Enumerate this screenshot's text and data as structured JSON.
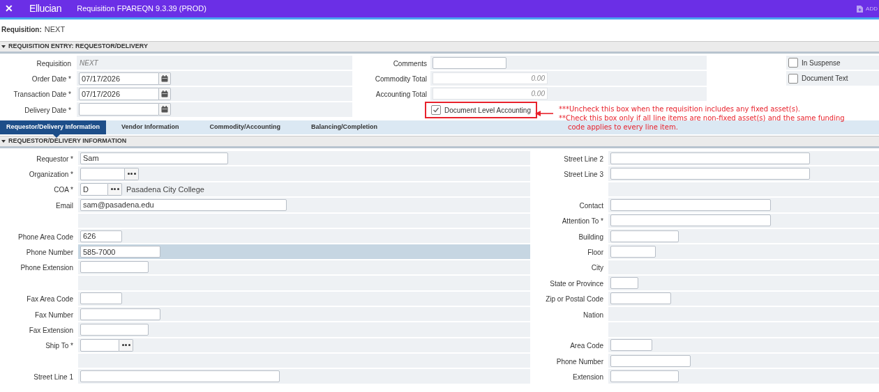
{
  "window": {
    "close": "✕",
    "logo": "Ellucian",
    "title": "Requisition FPAREQN 9.3.39 (PROD)",
    "action": "ADD"
  },
  "key_block": {
    "label": "Requisition:",
    "value": "NEXT"
  },
  "entry_section": {
    "title": "REQUISITION ENTRY: REQUESTOR/DELIVERY",
    "expanded": true,
    "left": [
      {
        "label": "Requisition",
        "kind": "display",
        "value": "NEXT"
      },
      {
        "label": "Order Date *",
        "kind": "date",
        "value": "07/17/2026"
      },
      {
        "label": "Transaction Date *",
        "kind": "date",
        "value": "07/17/2026"
      },
      {
        "label": "Delivery Date *",
        "kind": "date"
      }
    ],
    "middle": [
      {
        "label": "Comments",
        "kind": "text"
      },
      {
        "label": "Commodity Total",
        "kind": "amount",
        "value": "0.00"
      },
      {
        "label": "Accounting Total",
        "kind": "amount",
        "value": "0.00"
      },
      {
        "label": "Document Level Accounting",
        "kind": "checkbox",
        "checked": true,
        "highlighted": true
      }
    ],
    "right": [
      {
        "label": "In Suspense",
        "checked": false
      },
      {
        "label": "Document Text",
        "checked": false
      }
    ]
  },
  "annotation": [
    "***Uncheck this box when the requisition includes any fixed asset(s).",
    "**Check this box only if all line items are non-fixed asset(s) and the same funding",
    "code applies to every line item."
  ],
  "tabs": [
    {
      "label": "Requestor/Delivery Information",
      "selected": true
    },
    {
      "label": "Vendor Information",
      "selected": false
    },
    {
      "label": "Commodity/Accounting",
      "selected": false
    },
    {
      "label": "Balancing/Completion",
      "selected": false
    }
  ],
  "detail_section": {
    "title": "REQUESTOR/DELIVERY INFORMATION",
    "expanded": true,
    "left": [
      {
        "label": "Requestor *",
        "kind": "text",
        "value": "Sam"
      },
      {
        "label": "Organization *",
        "kind": "lookup"
      },
      {
        "label": "COA *",
        "kind": "lookup",
        "value": "D",
        "description": "Pasadena City College"
      },
      {
        "label": "Email",
        "kind": "text",
        "value": "sam@pasadena.edu"
      },
      {
        "kind": "blank"
      },
      {
        "label": "Phone Area Code",
        "kind": "text",
        "value": "626"
      },
      {
        "label": "Phone Number",
        "kind": "text",
        "value": "585-7000",
        "selected": true
      },
      {
        "label": "Phone Extension",
        "kind": "text"
      },
      {
        "kind": "blank"
      },
      {
        "label": "Fax Area Code",
        "kind": "text"
      },
      {
        "label": "Fax Number",
        "kind": "text"
      },
      {
        "label": "Fax Extension",
        "kind": "text"
      },
      {
        "label": "Ship To *",
        "kind": "lookup"
      },
      {
        "kind": "blank"
      },
      {
        "label": "Street Line 1",
        "kind": "text"
      }
    ],
    "right": [
      {
        "label": "Street Line 2",
        "kind": "text"
      },
      {
        "label": "Street Line 3",
        "kind": "text"
      },
      {
        "kind": "blank"
      },
      {
        "label": "Contact",
        "kind": "text"
      },
      {
        "label": "Attention To *",
        "kind": "text"
      },
      {
        "label": "Building",
        "kind": "text"
      },
      {
        "label": "Floor",
        "kind": "text"
      },
      {
        "label": "City",
        "kind": "none"
      },
      {
        "label": "State or Province",
        "kind": "text"
      },
      {
        "label": "Zip or Postal Code",
        "kind": "text"
      },
      {
        "label": "Nation",
        "kind": "none"
      },
      {
        "kind": "blank"
      },
      {
        "label": "Area Code",
        "kind": "text"
      },
      {
        "label": "Phone Number",
        "kind": "text"
      },
      {
        "label": "Extension",
        "kind": "text"
      }
    ]
  }
}
